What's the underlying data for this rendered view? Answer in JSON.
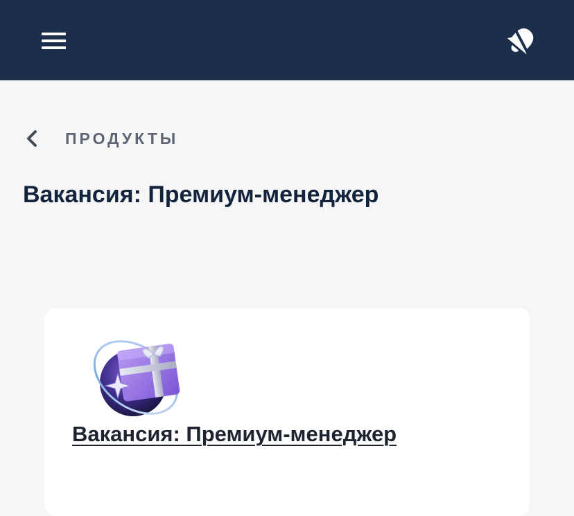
{
  "header": {
    "menu_icon": "hamburger-menu-icon",
    "notification_icon": "bell-off-icon",
    "background_color": "#1b2f4d"
  },
  "breadcrumb": {
    "back_icon": "chevron-left-icon",
    "label": "ПРОДУКТЫ"
  },
  "page": {
    "title": "Вакансия: Премиум-менеджер"
  },
  "card": {
    "illustration": "gift-box-orbit-icon",
    "link_text": "Вакансия: Премиум-менеджер"
  }
}
